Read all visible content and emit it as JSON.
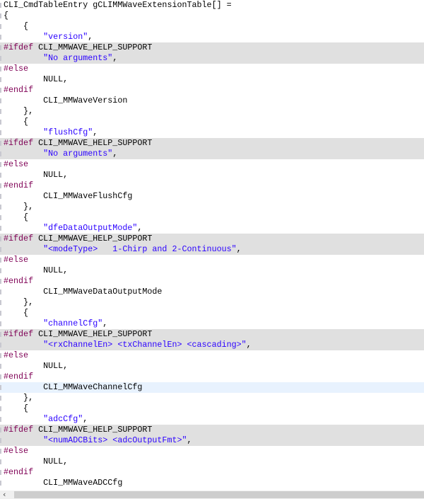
{
  "editor": {
    "colors": {
      "preprocessor": "#7f0055",
      "string": "#2a00ff",
      "preprocessor_bg": "#e0e0e0",
      "current_line_bg": "#e8f2fe"
    },
    "lines": [
      {
        "s": [
          [
            "",
            "CLI_CmdTableEntry gCLIMMWaveExtensionTable[] ="
          ]
        ]
      },
      {
        "s": [
          [
            "",
            "{"
          ]
        ]
      },
      {
        "s": [
          [
            "",
            "    {"
          ]
        ]
      },
      {
        "s": [
          [
            "",
            "        "
          ],
          [
            "str",
            "\"version\""
          ],
          [
            "",
            ","
          ]
        ]
      },
      {
        "bg": "pp",
        "s": [
          [
            "kw",
            "#ifdef"
          ],
          [
            "",
            " CLI_MMWAVE_HELP_SUPPORT"
          ]
        ]
      },
      {
        "bg": "pp",
        "s": [
          [
            "",
            "        "
          ],
          [
            "str",
            "\"No arguments\""
          ],
          [
            "",
            ","
          ]
        ]
      },
      {
        "s": [
          [
            "kw",
            "#else"
          ]
        ]
      },
      {
        "s": [
          [
            "",
            "        NULL,"
          ]
        ]
      },
      {
        "s": [
          [
            "kw",
            "#endif"
          ]
        ]
      },
      {
        "s": [
          [
            "",
            "        CLI_MMWaveVersion"
          ]
        ]
      },
      {
        "s": [
          [
            "",
            "    },"
          ]
        ]
      },
      {
        "s": [
          [
            "",
            "    {"
          ]
        ]
      },
      {
        "s": [
          [
            "",
            "        "
          ],
          [
            "str",
            "\"flushCfg\""
          ],
          [
            "",
            ","
          ]
        ]
      },
      {
        "bg": "pp",
        "s": [
          [
            "kw",
            "#ifdef"
          ],
          [
            "",
            " CLI_MMWAVE_HELP_SUPPORT"
          ]
        ]
      },
      {
        "bg": "pp",
        "s": [
          [
            "",
            "        "
          ],
          [
            "str",
            "\"No arguments\""
          ],
          [
            "",
            ","
          ]
        ]
      },
      {
        "s": [
          [
            "kw",
            "#else"
          ]
        ]
      },
      {
        "s": [
          [
            "",
            "        NULL,"
          ]
        ]
      },
      {
        "s": [
          [
            "kw",
            "#endif"
          ]
        ]
      },
      {
        "s": [
          [
            "",
            "        CLI_MMWaveFlushCfg"
          ]
        ]
      },
      {
        "s": [
          [
            "",
            "    },"
          ]
        ]
      },
      {
        "s": [
          [
            "",
            "    {"
          ]
        ]
      },
      {
        "s": [
          [
            "",
            "        "
          ],
          [
            "str",
            "\"dfeDataOutputMode\""
          ],
          [
            "",
            ","
          ]
        ]
      },
      {
        "bg": "pp",
        "s": [
          [
            "kw",
            "#ifdef"
          ],
          [
            "",
            " CLI_MMWAVE_HELP_SUPPORT"
          ]
        ]
      },
      {
        "bg": "pp",
        "s": [
          [
            "",
            "        "
          ],
          [
            "str",
            "\"<modeType>   1-Chirp and 2-Continuous\""
          ],
          [
            "",
            ","
          ]
        ]
      },
      {
        "s": [
          [
            "kw",
            "#else"
          ]
        ]
      },
      {
        "s": [
          [
            "",
            "        NULL,"
          ]
        ]
      },
      {
        "s": [
          [
            "kw",
            "#endif"
          ]
        ]
      },
      {
        "s": [
          [
            "",
            "        CLI_MMWaveDataOutputMode"
          ]
        ]
      },
      {
        "s": [
          [
            "",
            "    },"
          ]
        ]
      },
      {
        "s": [
          [
            "",
            "    {"
          ]
        ]
      },
      {
        "s": [
          [
            "",
            "        "
          ],
          [
            "str",
            "\"channelCfg\""
          ],
          [
            "",
            ","
          ]
        ]
      },
      {
        "bg": "pp",
        "s": [
          [
            "kw",
            "#ifdef"
          ],
          [
            "",
            " CLI_MMWAVE_HELP_SUPPORT"
          ]
        ]
      },
      {
        "bg": "pp",
        "s": [
          [
            "",
            "        "
          ],
          [
            "str",
            "\"<rxChannelEn> <txChannelEn> <cascading>\""
          ],
          [
            "",
            ","
          ]
        ]
      },
      {
        "s": [
          [
            "kw",
            "#else"
          ]
        ]
      },
      {
        "s": [
          [
            "",
            "        NULL,"
          ]
        ]
      },
      {
        "s": [
          [
            "kw",
            "#endif"
          ]
        ]
      },
      {
        "bg": "cur",
        "s": [
          [
            "",
            "        CLI_MMWaveChannelCfg"
          ]
        ]
      },
      {
        "s": [
          [
            "",
            "    },"
          ]
        ]
      },
      {
        "s": [
          [
            "",
            "    {"
          ]
        ]
      },
      {
        "s": [
          [
            "",
            "        "
          ],
          [
            "str",
            "\"adcCfg\""
          ],
          [
            "",
            ","
          ]
        ]
      },
      {
        "bg": "pp",
        "s": [
          [
            "kw",
            "#ifdef"
          ],
          [
            "",
            " CLI_MMWAVE_HELP_SUPPORT"
          ]
        ]
      },
      {
        "bg": "pp",
        "s": [
          [
            "",
            "        "
          ],
          [
            "str",
            "\"<numADCBits> <adcOutputFmt>\""
          ],
          [
            "",
            ","
          ]
        ]
      },
      {
        "s": [
          [
            "kw",
            "#else"
          ]
        ]
      },
      {
        "s": [
          [
            "",
            "        NULL,"
          ]
        ]
      },
      {
        "s": [
          [
            "kw",
            "#endif"
          ]
        ]
      },
      {
        "s": [
          [
            "",
            "        CLI_MMWaveADCCfg"
          ]
        ]
      }
    ]
  },
  "scrollbar": {
    "left_arrow_icon": "chevron-left-icon",
    "left_arrow_glyph": "‹"
  }
}
